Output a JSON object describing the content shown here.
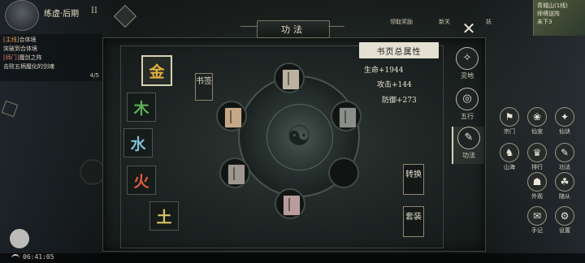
{
  "hud": {
    "player_name": "练虚",
    "realm": "·后期",
    "level": "II"
  },
  "quests": [
    {
      "tag": "[主线]",
      "text": "合体境",
      "tag_color": "orange"
    },
    {
      "tag": "",
      "text": "突破到合体境",
      "tag_color": ""
    },
    {
      "tag": "[师门]",
      "text": "魔剑之阵",
      "tag_color": "red"
    },
    {
      "tag": "",
      "text": "击败五柄魔化的剑魂",
      "tag_color": ""
    }
  ],
  "quest_count": "4/5",
  "top_strip": [
    "领取奖励",
    "新关",
    "妖"
  ],
  "minimap": {
    "location": "青城山(1线)",
    "subtitle": "师傅送阵",
    "status": "未下3"
  },
  "panel": {
    "title": "功法",
    "close_icon": "close-icon",
    "bookmark_label": "书签"
  },
  "elements": [
    {
      "label": "金",
      "color": "#e0b040",
      "selected": true
    },
    {
      "label": "木",
      "color": "#5fae5a",
      "selected": false
    },
    {
      "label": "水",
      "color": "#7ec0d8",
      "selected": false
    },
    {
      "label": "火",
      "color": "#e05a3a",
      "selected": false
    },
    {
      "label": "土",
      "color": "#d8c068",
      "selected": false
    }
  ],
  "slots": [
    {
      "name": "slot-top",
      "filled": true,
      "book_color": "#b9b2a2"
    },
    {
      "name": "slot-upper-right",
      "filled": true,
      "book_color": "#8a8e8a"
    },
    {
      "name": "slot-right",
      "filled": false,
      "book_color": ""
    },
    {
      "name": "slot-bottom",
      "filled": true,
      "book_color": "#b89c9c"
    },
    {
      "name": "slot-lower-left",
      "filled": true,
      "book_color": "#9c9890"
    },
    {
      "name": "slot-left",
      "filled": true,
      "book_color": "#c4a888"
    }
  ],
  "attributes": {
    "header": "书页总属性",
    "lines": [
      "生命+1944",
      "攻击+144",
      "防御+273"
    ]
  },
  "actions": {
    "switch": "转换",
    "equip": "套装"
  },
  "tabs": [
    {
      "icon": "spirit-root-icon",
      "glyph": "✧",
      "label": "灵地"
    },
    {
      "icon": "five-elements-icon",
      "glyph": "◎",
      "label": "五行"
    },
    {
      "icon": "technique-icon",
      "glyph": "✎",
      "label": "功法"
    }
  ],
  "menu": [
    {
      "icon": "sect-icon",
      "label": "宗门"
    },
    {
      "icon": "immortal-icon",
      "label": "仙宠"
    },
    {
      "icon": "secret-icon",
      "label": "仙诀"
    },
    {
      "icon": "beast-icon",
      "label": "山海"
    },
    {
      "icon": "ranking-icon",
      "label": "排行"
    },
    {
      "icon": "technique-menu-icon",
      "label": "功法"
    },
    {
      "icon": "appearance-icon",
      "label": "外观"
    },
    {
      "icon": "follower-icon",
      "label": "随从"
    },
    {
      "icon": "notes-icon",
      "label": "手记"
    },
    {
      "icon": "settings-icon",
      "label": "设置"
    }
  ],
  "clock": "06:41:05"
}
